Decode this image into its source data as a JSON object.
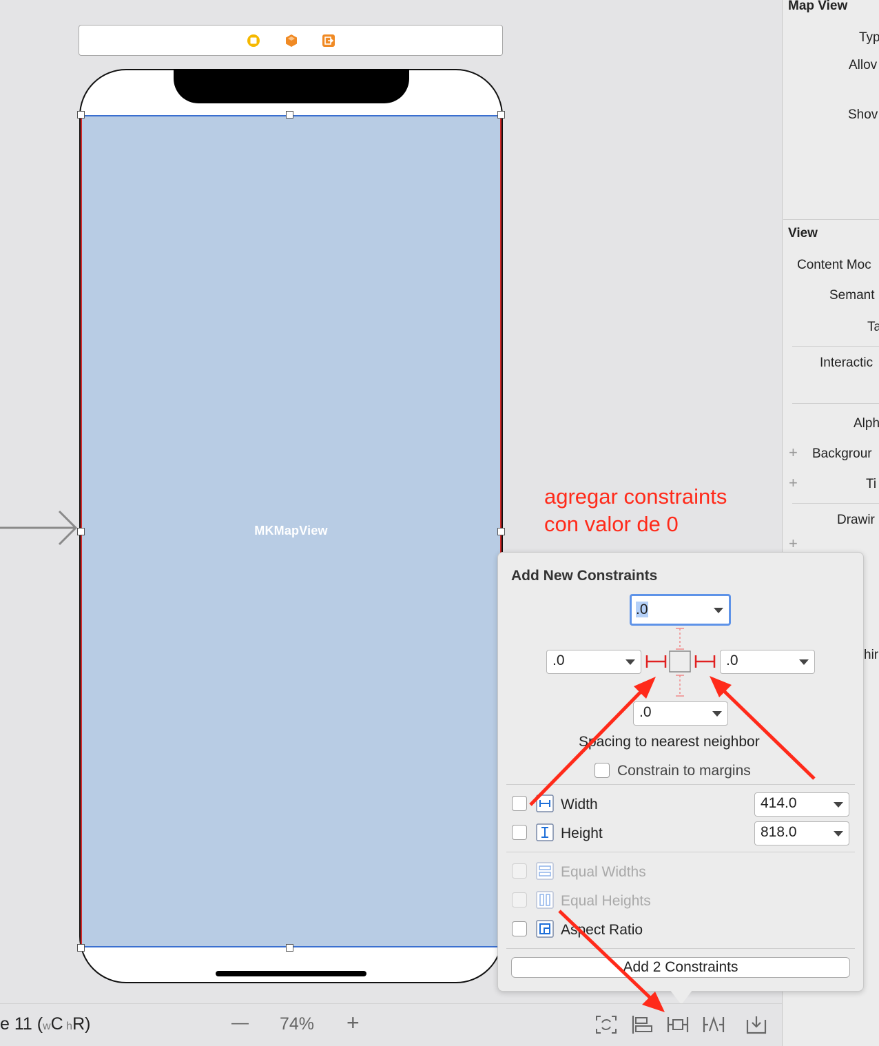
{
  "canvas": {
    "object_label": "MKMapView",
    "dock_icons": [
      "view-controller-icon",
      "first-responder-icon",
      "exit-icon"
    ]
  },
  "inspector": {
    "map_view_header": "Map View",
    "map_rows": [
      "Typ",
      "Allov",
      "Shov"
    ],
    "view_header": "View",
    "view_rows": [
      "Content Moc",
      "Semant",
      "Ta",
      "Interactic",
      "Alph",
      "Backgrour",
      "Ti",
      "Drawir"
    ],
    "extra_row": "hir"
  },
  "annotation": {
    "line1": "agregar constraints",
    "line2": "con valor de 0",
    "color": "#ff2a1a"
  },
  "popover": {
    "title": "Add New Constraints",
    "top_value": ".0",
    "left_value": ".0",
    "right_value": ".0",
    "bottom_value": ".0",
    "spacing_label": "Spacing to nearest neighbor",
    "margins_label": "Constrain to margins",
    "width_label": "Width",
    "width_value": "414.0",
    "height_label": "Height",
    "height_value": "818.0",
    "equal_widths_label": "Equal Widths",
    "equal_heights_label": "Equal Heights",
    "aspect_ratio_label": "Aspect Ratio",
    "add_button_label": "Add 2 Constraints"
  },
  "bottom_bar": {
    "device_prefix": "e 11 (",
    "size_w": "w",
    "size_c": "C",
    "size_h": "h",
    "size_r": "R)",
    "zoom_out": "—",
    "zoom_level": "74%",
    "zoom_in": "+"
  }
}
